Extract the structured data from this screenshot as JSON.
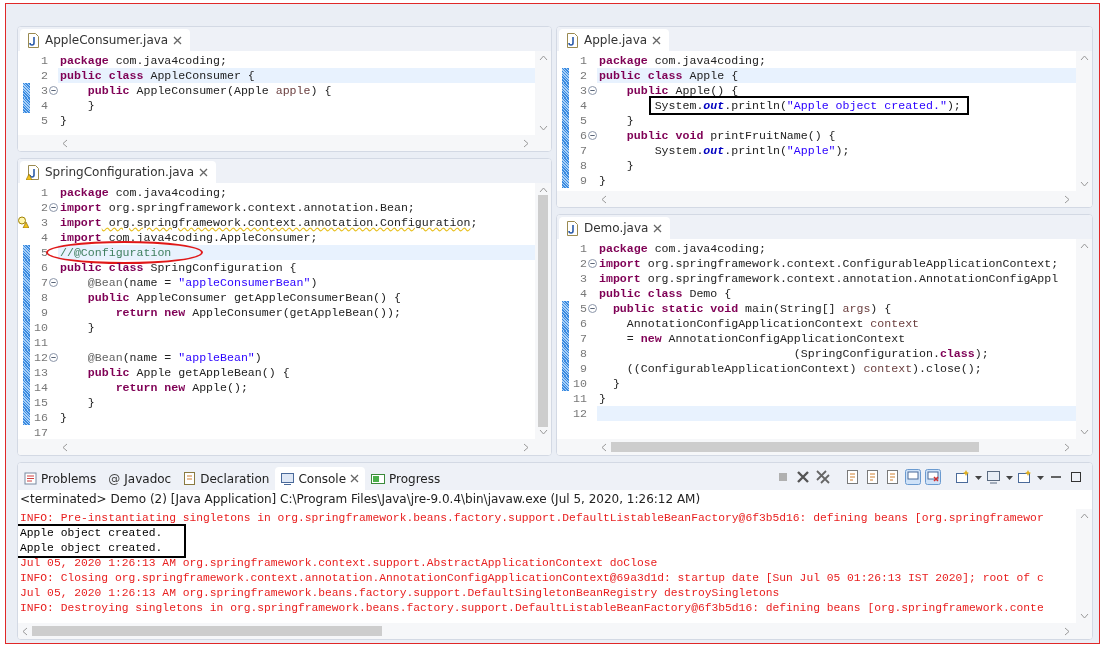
{
  "left_editors": [
    {
      "tab": {
        "label": "AppleConsumer.java",
        "selected": true,
        "warning": false
      },
      "v_thumb": false,
      "h_thumb": false,
      "lines": [
        {
          "num": "1",
          "kind": "line",
          "fold": false,
          "changed": false,
          "current": false,
          "warning": false,
          "tokens": [
            {
              "kind": "kw",
              "text": "package"
            },
            {
              "kind": "plain",
              "text": " com.java4coding;"
            }
          ]
        },
        {
          "num": "2",
          "kind": "line",
          "fold": false,
          "changed": false,
          "current": true,
          "warning": false,
          "tokens": [
            {
              "kind": "kw",
              "text": "public class"
            },
            {
              "kind": "plain",
              "text": " AppleConsumer {"
            }
          ]
        },
        {
          "num": "3",
          "kind": "line",
          "fold": true,
          "changed": true,
          "current": false,
          "warning": false,
          "tokens": [
            {
              "kind": "kw",
              "text": "    public"
            },
            {
              "kind": "plain",
              "text": " AppleConsumer(Apple "
            },
            {
              "kind": "param",
              "text": "apple"
            },
            {
              "kind": "plain",
              "text": ") {"
            }
          ]
        },
        {
          "num": "4",
          "kind": "line",
          "fold": false,
          "changed": true,
          "current": false,
          "warning": false,
          "tokens": [
            {
              "kind": "plain",
              "text": "    }"
            }
          ]
        },
        {
          "num": "5",
          "kind": "line",
          "fold": false,
          "changed": false,
          "current": false,
          "warning": false,
          "tokens": [
            {
              "kind": "plain",
              "text": "}"
            }
          ]
        }
      ]
    },
    {
      "tab": {
        "label": "SpringConfiguration.java",
        "selected": true,
        "warning": true
      },
      "v_thumb": true,
      "h_thumb": false,
      "lines": [
        {
          "num": "1",
          "kind": "line",
          "fold": false,
          "changed": false,
          "current": false,
          "warning": false,
          "tokens": [
            {
              "kind": "kw",
              "text": "package"
            },
            {
              "kind": "plain",
              "text": " com.java4coding;"
            }
          ]
        },
        {
          "num": "2",
          "kind": "line",
          "fold": true,
          "changed": false,
          "current": false,
          "warning": false,
          "tokens": [
            {
              "kind": "kw",
              "text": "import"
            },
            {
              "kind": "plain",
              "text": " org.springframework.context.annotation.Bean;"
            }
          ]
        },
        {
          "num": "3",
          "kind": "line",
          "fold": false,
          "changed": false,
          "current": false,
          "warning": true,
          "tokens": [
            {
              "kind": "kw",
              "text": "import"
            },
            {
              "kind": "warn",
              "text": " org.springframework.context.annotation.Configuration"
            },
            {
              "kind": "plain",
              "text": ";"
            }
          ]
        },
        {
          "num": "4",
          "kind": "line",
          "fold": false,
          "changed": false,
          "current": false,
          "warning": false,
          "tokens": [
            {
              "kind": "kw",
              "text": "import"
            },
            {
              "kind": "plain",
              "text": " com.java4coding.AppleConsumer;"
            }
          ]
        },
        {
          "num": "5",
          "kind": "circled",
          "fold": false,
          "changed": true,
          "current": true,
          "warning": false,
          "tokens": [
            {
              "kind": "comment",
              "text": "//@Configuration"
            }
          ]
        },
        {
          "num": "6",
          "kind": "line",
          "fold": false,
          "changed": true,
          "current": false,
          "warning": false,
          "tokens": [
            {
              "kind": "kw",
              "text": "public class"
            },
            {
              "kind": "plain",
              "text": " SpringConfiguration {"
            }
          ]
        },
        {
          "num": "7",
          "kind": "line",
          "fold": true,
          "changed": true,
          "current": false,
          "warning": false,
          "tokens": [
            {
              "kind": "ann",
              "text": "    @Bean"
            },
            {
              "kind": "plain",
              "text": "(name = "
            },
            {
              "kind": "str",
              "text": "\"appleConsumerBean\""
            },
            {
              "kind": "plain",
              "text": ")"
            }
          ]
        },
        {
          "num": "8",
          "kind": "line",
          "fold": false,
          "changed": true,
          "current": false,
          "warning": false,
          "tokens": [
            {
              "kind": "kw",
              "text": "    public"
            },
            {
              "kind": "plain",
              "text": " AppleConsumer getAppleConsumerBean() {"
            }
          ]
        },
        {
          "num": "9",
          "kind": "line",
          "fold": false,
          "changed": true,
          "current": false,
          "warning": false,
          "tokens": [
            {
              "kind": "kw",
              "text": "        return new"
            },
            {
              "kind": "plain",
              "text": " AppleConsumer(getAppleBean());"
            }
          ]
        },
        {
          "num": "10",
          "kind": "line",
          "fold": false,
          "changed": true,
          "current": false,
          "warning": false,
          "tokens": [
            {
              "kind": "plain",
              "text": "    }"
            }
          ]
        },
        {
          "num": "11",
          "kind": "line",
          "fold": false,
          "changed": true,
          "current": false,
          "warning": false
        },
        {
          "num": "12",
          "kind": "line",
          "fold": true,
          "changed": true,
          "current": false,
          "warning": false,
          "tokens": [
            {
              "kind": "ann",
              "text": "    @Bean"
            },
            {
              "kind": "plain",
              "text": "(name = "
            },
            {
              "kind": "str",
              "text": "\"appleBean\""
            },
            {
              "kind": "plain",
              "text": ")"
            }
          ]
        },
        {
          "num": "13",
          "kind": "line",
          "fold": false,
          "changed": true,
          "current": false,
          "warning": false,
          "tokens": [
            {
              "kind": "kw",
              "text": "    public"
            },
            {
              "kind": "plain",
              "text": " Apple getAppleBean() {"
            }
          ]
        },
        {
          "num": "14",
          "kind": "line",
          "fold": false,
          "changed": true,
          "current": false,
          "warning": false,
          "tokens": [
            {
              "kind": "kw",
              "text": "        return new"
            },
            {
              "kind": "plain",
              "text": " Apple();"
            }
          ]
        },
        {
          "num": "15",
          "kind": "line",
          "fold": false,
          "changed": true,
          "current": false,
          "warning": false,
          "tokens": [
            {
              "kind": "plain",
              "text": "    }"
            }
          ]
        },
        {
          "num": "16",
          "kind": "line",
          "fold": false,
          "changed": true,
          "current": false,
          "warning": false,
          "tokens": [
            {
              "kind": "plain",
              "text": "}"
            }
          ]
        },
        {
          "num": "17",
          "kind": "line",
          "fold": false,
          "changed": false,
          "current": false,
          "warning": false
        }
      ]
    }
  ],
  "right_editors": [
    {
      "tab": {
        "label": "Apple.java",
        "selected": true,
        "warning": false
      },
      "v_thumb": false,
      "h_thumb": false,
      "lines": [
        {
          "num": "1",
          "kind": "line",
          "fold": false,
          "changed": false,
          "current": false,
          "warning": false,
          "tokens": [
            {
              "kind": "kw",
              "text": "package"
            },
            {
              "kind": "plain",
              "text": " com.java4coding;"
            }
          ]
        },
        {
          "num": "2",
          "kind": "line",
          "fold": false,
          "changed": true,
          "current": true,
          "warning": false,
          "tokens": [
            {
              "kind": "kw",
              "text": "public class"
            },
            {
              "kind": "plain",
              "text": " Apple {"
            }
          ]
        },
        {
          "num": "3",
          "kind": "line",
          "fold": true,
          "changed": true,
          "current": false,
          "warning": false,
          "tokens": [
            {
              "kind": "kw",
              "text": "    public"
            },
            {
              "kind": "plain",
              "text": " Apple() {"
            }
          ]
        },
        {
          "num": "4",
          "kind": "boxed",
          "fold": false,
          "changed": true,
          "current": false,
          "warning": false,
          "tokens": [
            {
              "kind": "plain",
              "text": "        System."
            },
            {
              "kind": "field",
              "text": "out"
            },
            {
              "kind": "plain",
              "text": ".println("
            },
            {
              "kind": "str",
              "text": "\"Apple object created.\""
            },
            {
              "kind": "plain",
              "text": ");"
            }
          ]
        },
        {
          "num": "5",
          "kind": "line",
          "fold": false,
          "changed": true,
          "current": false,
          "warning": false,
          "tokens": [
            {
              "kind": "plain",
              "text": "    }"
            }
          ]
        },
        {
          "num": "6",
          "kind": "line",
          "fold": true,
          "changed": true,
          "current": false,
          "warning": false,
          "tokens": [
            {
              "kind": "kw",
              "text": "    public void"
            },
            {
              "kind": "plain",
              "text": " printFruitName() {"
            }
          ]
        },
        {
          "num": "7",
          "kind": "line",
          "fold": false,
          "changed": true,
          "current": false,
          "warning": false,
          "tokens": [
            {
              "kind": "plain",
              "text": "        System."
            },
            {
              "kind": "field",
              "text": "out"
            },
            {
              "kind": "plain",
              "text": ".println("
            },
            {
              "kind": "str",
              "text": "\"Apple\""
            },
            {
              "kind": "plain",
              "text": ");"
            }
          ]
        },
        {
          "num": "8",
          "kind": "line",
          "fold": false,
          "changed": true,
          "current": false,
          "warning": false,
          "tokens": [
            {
              "kind": "plain",
              "text": "    }"
            }
          ]
        },
        {
          "num": "9",
          "kind": "line",
          "fold": false,
          "changed": true,
          "current": false,
          "warning": false,
          "tokens": [
            {
              "kind": "plain",
              "text": "}"
            }
          ]
        }
      ]
    },
    {
      "tab": {
        "label": "Demo.java",
        "selected": true,
        "warning": false
      },
      "v_thumb": false,
      "h_thumb": true,
      "lines": [
        {
          "num": "1",
          "kind": "line",
          "fold": false,
          "changed": false,
          "current": false,
          "warning": false,
          "tokens": [
            {
              "kind": "kw",
              "text": "package"
            },
            {
              "kind": "plain",
              "text": " com.java4coding;"
            }
          ]
        },
        {
          "num": "2",
          "kind": "line",
          "fold": true,
          "changed": false,
          "current": false,
          "warning": false,
          "tokens": [
            {
              "kind": "kw",
              "text": "import"
            },
            {
              "kind": "plain",
              "text": " org.springframework.context.ConfigurableApplicationContext;"
            }
          ]
        },
        {
          "num": "3",
          "kind": "line",
          "fold": false,
          "changed": false,
          "current": false,
          "warning": false,
          "tokens": [
            {
              "kind": "kw",
              "text": "import"
            },
            {
              "kind": "plain",
              "text": " org.springframework.context.annotation.AnnotationConfigAppl"
            }
          ]
        },
        {
          "num": "4",
          "kind": "line",
          "fold": false,
          "changed": false,
          "current": false,
          "warning": false,
          "tokens": [
            {
              "kind": "kw",
              "text": "public class"
            },
            {
              "kind": "plain",
              "text": " Demo {"
            }
          ]
        },
        {
          "num": "5",
          "kind": "line",
          "fold": true,
          "changed": true,
          "current": false,
          "warning": false,
          "tokens": [
            {
              "kind": "kw",
              "text": "  public static void"
            },
            {
              "kind": "plain",
              "text": " main(String[] "
            },
            {
              "kind": "param",
              "text": "args"
            },
            {
              "kind": "plain",
              "text": ") {"
            }
          ]
        },
        {
          "num": "6",
          "kind": "line",
          "fold": false,
          "changed": true,
          "current": false,
          "warning": false,
          "tokens": [
            {
              "kind": "plain",
              "text": "    AnnotationConfigApplicationContext "
            },
            {
              "kind": "param",
              "text": "context"
            }
          ]
        },
        {
          "num": "7",
          "kind": "line",
          "fold": false,
          "changed": true,
          "current": false,
          "warning": false,
          "tokens": [
            {
              "kind": "plain",
              "text": "    = "
            },
            {
              "kind": "kw",
              "text": "new"
            },
            {
              "kind": "plain",
              "text": " AnnotationConfigApplicationContext"
            }
          ]
        },
        {
          "num": "8",
          "kind": "line",
          "fold": false,
          "changed": true,
          "current": false,
          "warning": false,
          "tokens": [
            {
              "kind": "plain",
              "text": "                            (SpringConfiguration."
            },
            {
              "kind": "kw",
              "text": "class"
            },
            {
              "kind": "plain",
              "text": ");"
            }
          ]
        },
        {
          "num": "9",
          "kind": "line",
          "fold": false,
          "changed": true,
          "current": false,
          "warning": false,
          "tokens": [
            {
              "kind": "plain",
              "text": "    ((ConfigurableApplicationContext) "
            },
            {
              "kind": "param",
              "text": "context"
            },
            {
              "kind": "plain",
              "text": ").close();"
            }
          ]
        },
        {
          "num": "10",
          "kind": "line",
          "fold": false,
          "changed": true,
          "current": false,
          "warning": false,
          "tokens": [
            {
              "kind": "plain",
              "text": "  }"
            }
          ]
        },
        {
          "num": "11",
          "kind": "line",
          "fold": false,
          "changed": false,
          "current": false,
          "warning": false,
          "tokens": [
            {
              "kind": "plain",
              "text": "}"
            }
          ]
        },
        {
          "num": "12",
          "kind": "line",
          "fold": false,
          "changed": false,
          "current": true,
          "warning": false
        }
      ]
    }
  ],
  "console": {
    "tabs": [
      {
        "label": "Problems",
        "selected": false
      },
      {
        "label": "Javadoc",
        "glyph": "@",
        "selected": false
      },
      {
        "label": "Declaration",
        "selected": false
      },
      {
        "label": "Console",
        "selected": true
      },
      {
        "label": "Progress",
        "selected": false
      }
    ],
    "status": "<terminated> Demo (2) [Java Application] C:\\Program Files\\Java\\jre-9.0.4\\bin\\javaw.exe (Jul 5, 2020, 1:26:12 AM)",
    "h_thumb": true,
    "output": [
      {
        "kind": "err",
        "text": "INFO: Pre-instantiating singletons in org.springframework.beans.factory.support.DefaultListableBeanFactory@6f3b5d16: defining beans [org.springframewor"
      },
      {
        "kind": "box",
        "lines": [
          {
            "kind": "out",
            "text": "Apple object created."
          },
          {
            "kind": "out",
            "text": "Apple object created."
          }
        ]
      },
      {
        "kind": "err",
        "text": "Jul 05, 2020 1:26:13 AM org.springframework.context.support.AbstractApplicationContext doClose"
      },
      {
        "kind": "err",
        "text": "INFO: Closing org.springframework.context.annotation.AnnotationConfigApplicationContext@69a3d1d: startup date [Sun Jul 05 01:26:13 IST 2020]; root of c"
      },
      {
        "kind": "err",
        "text": "Jul 05, 2020 1:26:13 AM org.springframework.beans.factory.support.DefaultSingletonBeanRegistry destroySingletons"
      },
      {
        "kind": "err",
        "text": "INFO: Destroying singletons in org.springframework.beans.factory.support.DefaultListableBeanFactory@6f3b5d16: defining beans [org.springframework.conte"
      }
    ]
  }
}
